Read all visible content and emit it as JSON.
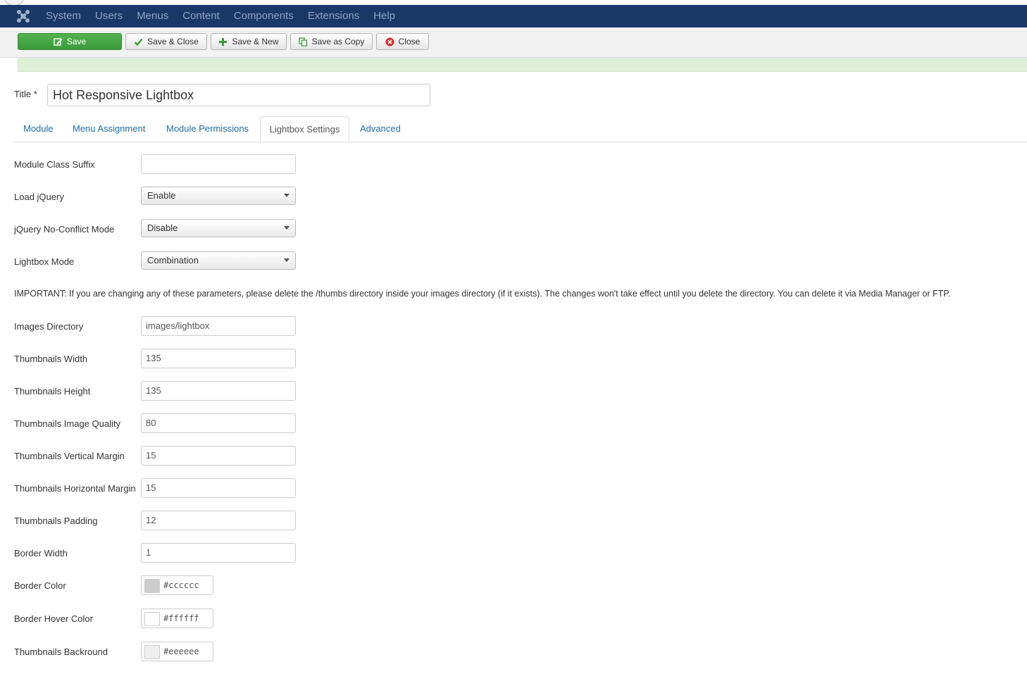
{
  "navbar": {
    "menu": [
      "System",
      "Users",
      "Menus",
      "Content",
      "Components",
      "Extensions",
      "Help"
    ]
  },
  "toolbar": {
    "save": "Save",
    "save_close": "Save & Close",
    "save_new": "Save & New",
    "save_copy": "Save as Copy",
    "close": "Close"
  },
  "form": {
    "title_label": "Title *",
    "title_value": "Hot Responsive Lightbox"
  },
  "tabs": [
    "Module",
    "Menu Assignment",
    "Module Permissions",
    "Lightbox Settings",
    "Advanced"
  ],
  "active_tab": "Lightbox Settings",
  "fields": {
    "module_class_suffix": {
      "label": "Module Class Suffix",
      "value": ""
    },
    "load_jquery": {
      "label": "Load jQuery",
      "value": "Enable"
    },
    "jquery_noconflict": {
      "label": "jQuery No-Conflict Mode",
      "value": "Disable"
    },
    "lightbox_mode": {
      "label": "Lightbox Mode",
      "value": "Combination"
    },
    "important": "IMPORTANT: If you are changing any of these parameters, please delete the /thumbs directory inside your images directory (if it exists). The changes won't take effect until you delete the directory. You can delete it via Media Manager or FTP.",
    "images_directory": {
      "label": "Images Directory",
      "value": "images/lightbox"
    },
    "thumb_width": {
      "label": "Thumbnails Width",
      "value": "135"
    },
    "thumb_height": {
      "label": "Thumbnails Height",
      "value": "135"
    },
    "thumb_quality": {
      "label": "Thumbnails Image Quality",
      "value": "80"
    },
    "thumb_vmargin": {
      "label": "Thumbnails Vertical Margin",
      "value": "15"
    },
    "thumb_hmargin": {
      "label": "Thumbnails Horizontal Margin",
      "value": "15"
    },
    "thumb_padding": {
      "label": "Thumbnails Padding",
      "value": "12"
    },
    "border_width": {
      "label": "Border Width",
      "value": "1"
    },
    "border_color": {
      "label": "Border Color",
      "value": "#cccccc"
    },
    "border_hover_color": {
      "label": "Border Hover Color",
      "value": "#ffffff"
    },
    "thumb_background": {
      "label": "Thumbnails Backround",
      "value": "#eeeeee"
    }
  },
  "colors": {
    "navbar": "#1a3867",
    "primary_button": "#46a546",
    "link": "#1d6fa5",
    "success_bar": "#dff0d8"
  }
}
